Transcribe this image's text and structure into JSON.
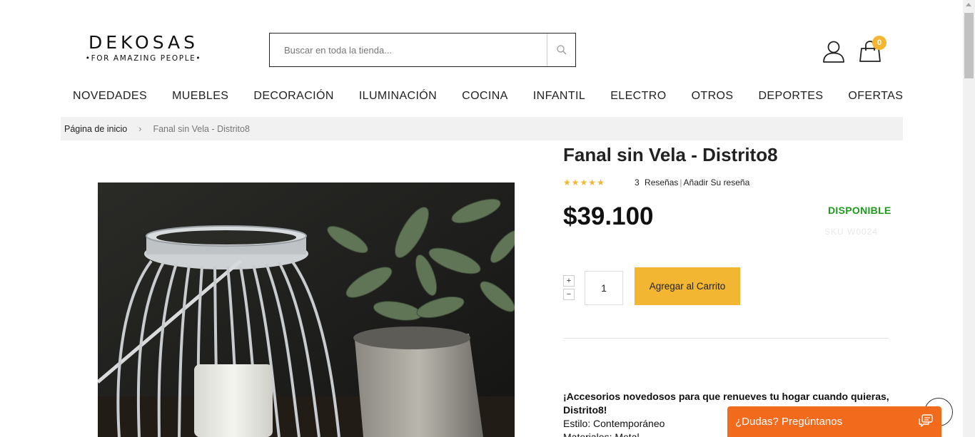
{
  "header": {
    "logo": {
      "brand": "DEKOSAS",
      "tagline": "•FOR AMAZING PEOPLE•"
    },
    "search": {
      "placeholder": "Buscar en toda la tienda...",
      "icon": "search-icon"
    },
    "account": {
      "icon": "user-icon"
    },
    "cart": {
      "icon": "shopping-bag-icon",
      "count": "0",
      "badge_color": "#f2b632"
    }
  },
  "nav": {
    "items": [
      {
        "label": "NOVEDADES"
      },
      {
        "label": "MUEBLES"
      },
      {
        "label": "DECORACIÓN"
      },
      {
        "label": "ILUMINACIÓN"
      },
      {
        "label": "COCINA"
      },
      {
        "label": "INFANTIL"
      },
      {
        "label": "ELECTRO"
      },
      {
        "label": "OTROS"
      },
      {
        "label": "DEPORTES"
      },
      {
        "label": "OFERTAS"
      }
    ]
  },
  "breadcrumb": {
    "home": "Página de inicio",
    "separator": "›",
    "current": "Fanal sin Vela - Distrito8"
  },
  "product": {
    "title": "Fanal sin Vela - Distrito8",
    "rating": {
      "stars": 5,
      "out_of": 5,
      "color": "#f2b632"
    },
    "reviews": {
      "count": "3",
      "reviews_label": "Reseñas",
      "separator": "|",
      "add_review_label": "Añadir Su reseña"
    },
    "price": "$39.100",
    "stock_status": "DISPONIBLE",
    "stock_color": "#1f9a1f",
    "sku": "SKU   W0024",
    "quantity": {
      "plus": "+",
      "minus": "−",
      "value": "1"
    },
    "add_to_cart_label": "Agregar al Carrito",
    "accent_color": "#f2b632",
    "description": {
      "lead": "¡Accesorios novedosos para que renueves tu hogar cuando quieras, Distrito8!",
      "style": "Estilo: Contemporáneo",
      "materials": "Materiales: Metal"
    }
  },
  "chat": {
    "label": "¿Dudas? Pregúntanos",
    "icon": "chat-bubble-icon",
    "color": "#f26b1d"
  }
}
